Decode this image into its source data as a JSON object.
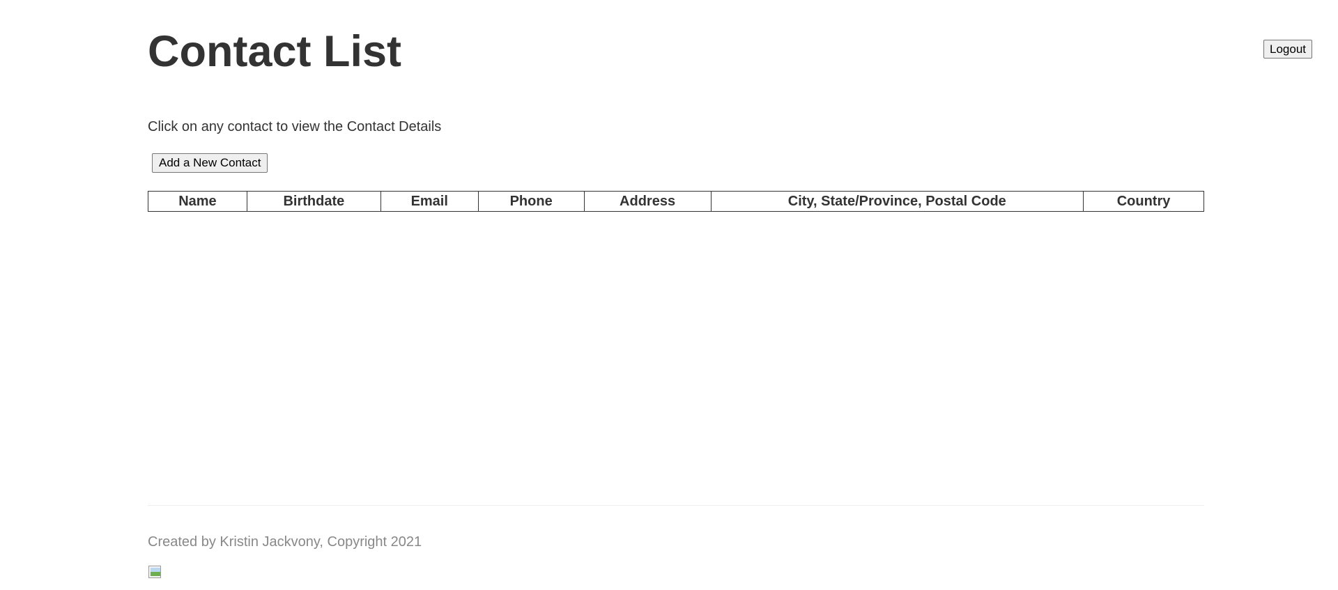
{
  "header": {
    "title": "Contact List",
    "logout_label": "Logout"
  },
  "main": {
    "intro": "Click on any contact to view the Contact Details",
    "add_contact_label": "Add a New Contact",
    "table": {
      "columns": [
        "Name",
        "Birthdate",
        "Email",
        "Phone",
        "Address",
        "City, State/Province, Postal Code",
        "Country"
      ],
      "rows": []
    }
  },
  "footer": {
    "text": "Created by Kristin Jackvony, Copyright 2021",
    "image_icon": "broken-image-icon"
  }
}
